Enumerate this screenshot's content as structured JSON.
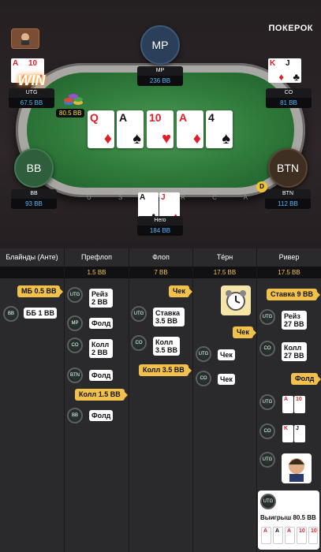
{
  "brand": "ПОКЕРОК",
  "seats": {
    "mp": {
      "label": "MP",
      "name": "MP",
      "stack": "236 BB"
    },
    "utg": {
      "name": "UTG",
      "stack": "67.5 BB"
    },
    "co": {
      "name": "CO",
      "stack": "81 BB"
    },
    "bb": {
      "label": "BB",
      "name": "BB",
      "stack": "93 BB"
    },
    "btn": {
      "label": "BTN",
      "name": "BTN",
      "stack": "112 BB"
    },
    "hero": {
      "name": "Hero",
      "stack": "184 BB"
    }
  },
  "win_text": "WIN",
  "pot": "80.5 BB",
  "dealer": "D",
  "rail_text": "U  S  E  R  C  A  S",
  "board": [
    {
      "rank": "Q",
      "suit": "♦",
      "color": "red"
    },
    {
      "rank": "A",
      "suit": "♠",
      "color": "blk"
    },
    {
      "rank": "10",
      "suit": "♥",
      "color": "red"
    },
    {
      "rank": "A",
      "suit": "♦",
      "color": "red"
    },
    {
      "rank": "4",
      "suit": "♠",
      "color": "blk"
    }
  ],
  "utg_cards": [
    {
      "rank": "A",
      "suit": "♦"
    },
    {
      "rank": "10",
      "suit": "♥"
    }
  ],
  "co_cards": [
    {
      "rank": "K",
      "suit": "♦"
    },
    {
      "rank": "J",
      "suit": "♣"
    }
  ],
  "hero_cards": [
    {
      "rank": "A",
      "suit": "♣"
    },
    {
      "rank": "J",
      "suit": "♦"
    }
  ],
  "streets": [
    {
      "name": "Блайнды (Анте)",
      "pot": ""
    },
    {
      "name": "Префлоп",
      "pot": "1.5 BB"
    },
    {
      "name": "Флоп",
      "pot": "7 BB"
    },
    {
      "name": "Тёрн",
      "pot": "17.5 BB"
    },
    {
      "name": "Ривер",
      "pot": "17.5 BB"
    }
  ],
  "actions": {
    "sb": "МБ 0.5 BB",
    "bb_pos": "BB",
    "bb": "ББ 1 BB",
    "utg_pos": "UTG",
    "pre_utg": "Рейз 2 BB",
    "mp_pos": "MP",
    "pre_mp": "Фолд",
    "co_pos": "CO",
    "pre_co": "Колл 2 BB",
    "btn_pos": "BTN",
    "pre_btn": "Фолд",
    "pre_sb": "Колл 1.5 BB",
    "pre_bb": "Фолд",
    "flop_check": "Чек",
    "flop_utg": "Ставка 3.5 BB",
    "flop_co": "Колл 3.5 BB",
    "flop_co_tag": "Колл 3.5 BB",
    "turn_check_tag": "Чек",
    "turn_utg": "Чек",
    "turn_co": "Чек",
    "river_tag": "Ставка 9 BB",
    "river_utg": "Рейз 27 BB",
    "river_co": "Колл 27 BB",
    "river_fold_tag": "Фолд",
    "winnings": "Выигрыш 80.5 BB"
  }
}
